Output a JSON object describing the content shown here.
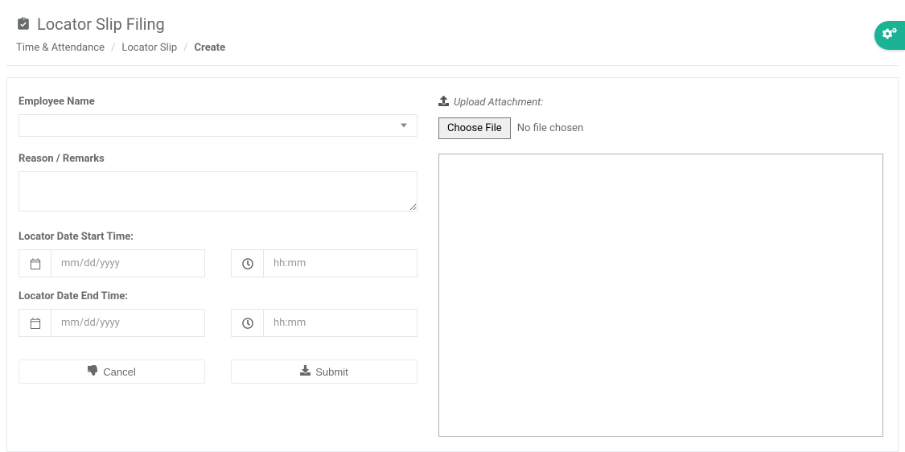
{
  "header": {
    "title": "Locator Slip Filing",
    "breadcrumb": {
      "items": [
        "Time & Attendance",
        "Locator Slip"
      ],
      "current": "Create",
      "sep": "/"
    }
  },
  "form": {
    "employee_label": "Employee Name",
    "reason_label": "Reason / Remarks",
    "start_label": "Locator Date Start Time:",
    "end_label": "Locator Date End Time:",
    "date_placeholder": "mm/dd/yyyy",
    "time_placeholder": "hh:mm",
    "cancel_label": "Cancel",
    "submit_label": "Submit"
  },
  "upload": {
    "label": "Upload Attachment:",
    "choose_label": "Choose File",
    "status": "No file chosen"
  }
}
